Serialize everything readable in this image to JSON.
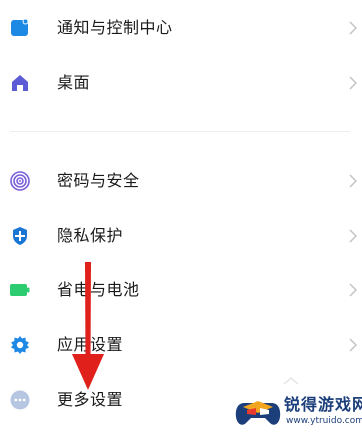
{
  "settings": {
    "items": [
      {
        "label": "通知与控制中心",
        "icon": "notification-icon",
        "color": "#1e88e5",
        "chevron": true
      },
      {
        "label": "桌面",
        "icon": "home-icon",
        "color": "#5c5bd6",
        "chevron": true
      },
      {
        "label": "密码与安全",
        "icon": "fingerprint-icon",
        "color": "#7b61d8",
        "chevron": true
      },
      {
        "label": "隐私保护",
        "icon": "privacy-shield-icon",
        "color": "#1976d2",
        "chevron": true
      },
      {
        "label": "省电与电池",
        "icon": "battery-icon",
        "color": "#2ecc71",
        "chevron": true
      },
      {
        "label": "应用设置",
        "icon": "gear-icon",
        "color": "#1e88e5",
        "chevron": true
      },
      {
        "label": "更多设置",
        "icon": "more-dots-icon",
        "color": "#8fa6c9",
        "chevron": false
      }
    ]
  },
  "annotation": {
    "icon": "red-down-arrow",
    "color": "#e0201a"
  },
  "watermark": {
    "brand": "锐得游戏网",
    "url": "www.ytruido.com",
    "color": "#1c3f7c"
  }
}
